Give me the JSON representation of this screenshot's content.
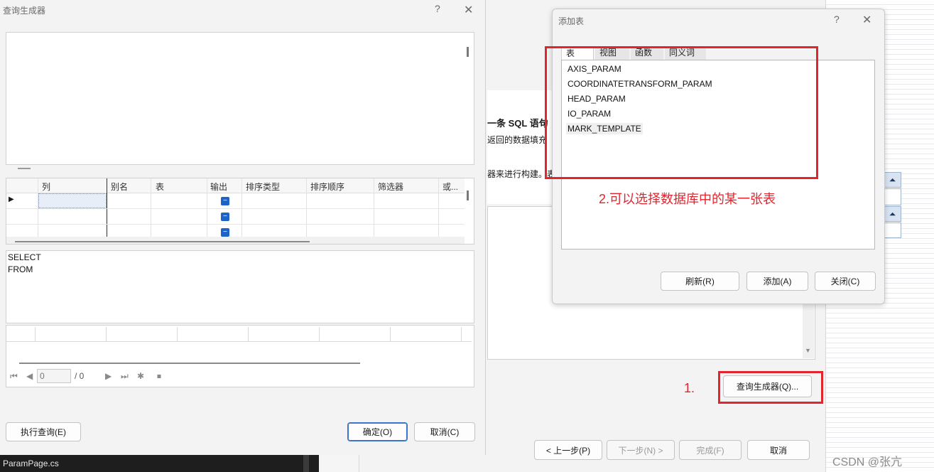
{
  "query_builder": {
    "title": "查询生成器",
    "help": "?",
    "close": "✕",
    "grid_headers": [
      "列",
      "别名",
      "表",
      "输出",
      "排序类型",
      "排序顺序",
      "筛选器",
      "或..."
    ],
    "sql_lines": [
      "SELECT",
      "FROM"
    ],
    "nav": {
      "position": "0",
      "total": "/ 0"
    },
    "execute_label": "执行查询(E)",
    "ok_label": "确定(O)",
    "cancel_label": "取消(C)"
  },
  "add_table": {
    "title": "添加表",
    "help": "?",
    "close": "✕",
    "tabs": [
      "表",
      "视图",
      "函数",
      "同义词"
    ],
    "tables": [
      "AXIS_PARAM",
      "COORDINATETRANSFORM_PARAM",
      "HEAD_PARAM",
      "IO_PARAM",
      "MARK_TEMPLATE"
    ],
    "refresh_label": "刷新(R)",
    "add_label": "添加(A)",
    "close_label": "关闭(C)"
  },
  "wizard": {
    "text1": "一条 SQL 语句",
    "text2": "返回的数据填充",
    "text3": "器来进行构建。表",
    "query_builder_button": "查询生成器(Q)...",
    "back_label": "< 上一步(P)",
    "next_label": "下一步(N) >",
    "finish_label": "完成(F)",
    "cancel_label": "取消"
  },
  "annotations": {
    "step1": "1.",
    "step2": "2.可以选择数据库中的某一张表",
    "color": "#e0252e"
  },
  "taskbar": {
    "file": "ParamPage.cs"
  },
  "watermark": "CSDN @张亢"
}
